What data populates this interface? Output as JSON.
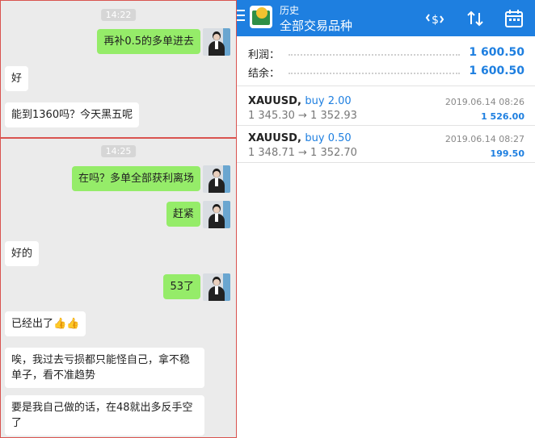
{
  "chat": {
    "panel1": {
      "timestamp": "14:22",
      "messages": [
        {
          "side": "out",
          "text": "再补0.5的多单进去"
        },
        {
          "side": "in",
          "text": "好"
        },
        {
          "side": "in",
          "text": "能到1360吗？今天黑五呢"
        }
      ]
    },
    "panel2": {
      "timestamp": "14:25",
      "messages": [
        {
          "side": "out",
          "text": "在吗？多单全部获利离场"
        },
        {
          "side": "out",
          "text": "赶紧"
        },
        {
          "side": "in",
          "text": "好的"
        },
        {
          "side": "out",
          "text": "53了"
        },
        {
          "side": "in",
          "text": "已经出了👍👍"
        },
        {
          "side": "in",
          "text": "唉，我过去亏损都只能怪自己，拿不稳单子，看不准趋势"
        },
        {
          "side": "in",
          "text": "要是我自己做的话，在48就出多反手空了"
        }
      ]
    }
  },
  "trading": {
    "header": {
      "title_small": "历史",
      "title": "全部交易品种"
    },
    "icons": [
      "menu-icon",
      "app-logo-icon",
      "currency-exchange-icon",
      "sort-icon",
      "calendar-icon"
    ],
    "summary": [
      {
        "label": "利润：",
        "value": "1 600.50"
      },
      {
        "label": "结余：",
        "value": "1 600.50"
      }
    ],
    "trades": [
      {
        "symbol": "XAUUSD,",
        "action": "buy 2.00",
        "prices": "1 345.30 → 1 352.93",
        "date": "2019.06.14 08:26",
        "profit": "1 526.00"
      },
      {
        "symbol": "XAUUSD,",
        "action": "buy 0.50",
        "prices": "1 348.71 → 1 352.70",
        "date": "2019.06.14 08:27",
        "profit": "199.50"
      }
    ],
    "accent_color": "#1e7fe0"
  }
}
